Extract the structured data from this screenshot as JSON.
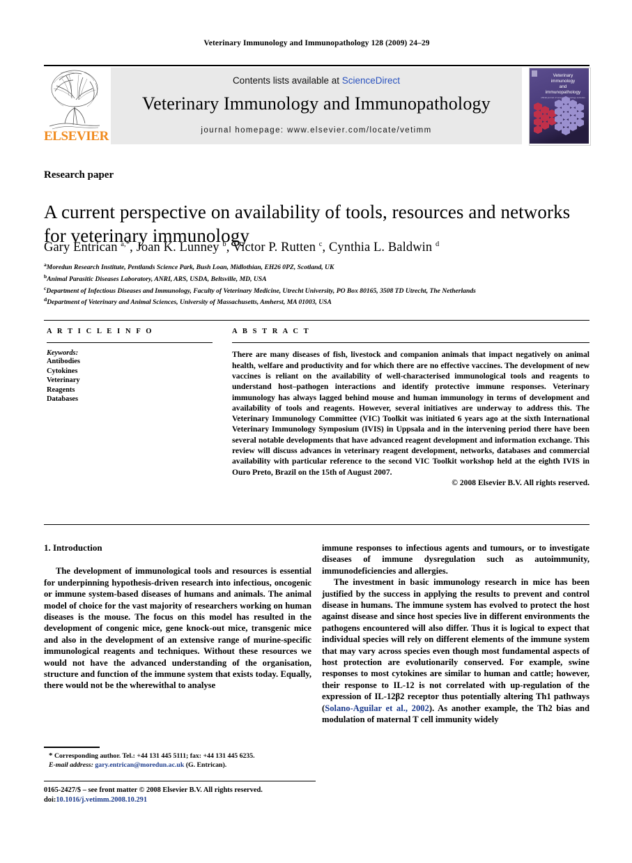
{
  "running_head": "Veterinary Immunology and Immunopathology 128 (2009) 24–29",
  "masthead": {
    "contents_prefix": "Contents lists available at ",
    "sciencedirect": "ScienceDirect",
    "journal_title": "Veterinary Immunology and Immunopathology",
    "homepage": "journal homepage: www.elsevier.com/locate/vetimm",
    "publisher": "ELSEVIER",
    "publisher_color": "#f08a1d",
    "cover": {
      "line1": "Veterinary",
      "line2": "immunology",
      "line3": "and",
      "line4": "immunopathology",
      "subtitle": "official journal of several immunology societies",
      "bg_color": "#4a3c7a",
      "accent_red": "#c0304a",
      "accent_purple": "#9b90cf"
    }
  },
  "article": {
    "type": "Research paper",
    "title": "A current perspective on availability of tools, resources and networks for veterinary immunology",
    "authors_html": "Gary Entrican <sup>a,*</sup>, Joan K. Lunney <sup>b</sup>, Victor P. Rutten <sup>c</sup>, Cynthia L. Baldwin <sup>d</sup>",
    "affiliations": [
      {
        "marker": "a",
        "text": "Moredun Research Institute, Pentlands Science Park, Bush Loan, Midlothian, EH26 0PZ, Scotland, UK"
      },
      {
        "marker": "b",
        "text": "Animal Parasitic Diseases Laboratory, ANRI, ARS, USDA, Beltsville, MD, USA"
      },
      {
        "marker": "c",
        "text": "Department of Infectious Diseases and Immunology, Faculty of Veterinary Medicine, Utrecht University, PO Box 80165, 3508 TD Utrecht, The Netherlands"
      },
      {
        "marker": "d",
        "text": "Department of Veterinary and Animal Sciences, University of Massachusetts, Amherst, MA 01003, USA"
      }
    ]
  },
  "article_info": {
    "heading": "A R T I C L E   I N F O",
    "keywords_label": "Keywords:",
    "keywords": [
      "Antibodies",
      "Cytokines",
      "Veterinary",
      "Reagents",
      "Databases"
    ]
  },
  "abstract": {
    "heading": "A B S T R A C T",
    "text": "There are many diseases of fish, livestock and companion animals that impact negatively on animal health, welfare and productivity and for which there are no effective vaccines. The development of new vaccines is reliant on the availability of well-characterised immunological tools and reagents to understand host–pathogen interactions and identify protective immune responses. Veterinary immunology has always lagged behind mouse and human immunology in terms of development and availability of tools and reagents. However, several initiatives are underway to address this. The Veterinary Immunology Committee (VIC) Toolkit was initiated 6 years ago at the sixth International Veterinary Immunology Symposium (IVIS) in Uppsala and in the intervening period there have been several notable developments that have advanced reagent development and information exchange. This review will discuss advances in veterinary reagent development, networks, databases and commercial availability with particular reference to the second VIC Toolkit workshop held at the eighth IVIS in Ouro Preto, Brazil on the 15th of August 2007.",
    "copyright": "© 2008 Elsevier B.V. All rights reserved."
  },
  "body": {
    "section_title": "1. Introduction",
    "left_paragraphs": [
      "The development of immunological tools and resources is essential for underpinning hypothesis-driven research into infectious, oncogenic or immune system-based diseases of humans and animals. The animal model of choice for the vast majority of researchers working on human diseases is the mouse. The focus on this model has resulted in the development of congenic mice, gene knock-out mice, transgenic mice and also in the development of an extensive range of murine-specific immunological reagents and techniques. Without these resources we would not have the advanced understanding of the organisation, structure and function of the immune system that exists today. Equally, there would not be the wherewithal to analyse"
    ],
    "right_paragraph_continuation": "immune responses to infectious agents and tumours, or to investigate diseases of immune dysregulation such as autoimmunity, immunodeficiencies and allergies.",
    "right_paragraph_2_part1": "The investment in basic immunology research in mice has been justified by the success in applying the results to prevent and control disease in humans. The immune system has evolved to protect the host against disease and since host species live in different environments the pathogens encountered will also differ. Thus it is logical to expect that individual species will rely on different elements of the immune system that may vary across species even though most fundamental aspects of host protection are evolutionarily conserved. For example, swine responses to most cytokines are similar to human and cattle; however, their response to IL-12 is not correlated with up-regulation of the expression of IL-12β2 receptor thus potentially altering Th1 pathways (",
    "right_citation": "Solano-Aguilar et al., 2002",
    "right_paragraph_2_part2": "). As another example, the Th2 bias and modulation of maternal T cell immunity widely"
  },
  "footnotes": {
    "marker": "*",
    "corresponding": "Corresponding author. Tel.: +44 131 445 5111; fax: +44 131 445 6235.",
    "email_label": "E-mail address:",
    "email": "gary.entrican@moredun.ac.uk",
    "email_owner": "(G. Entrican).",
    "issn_line": "0165-2427/$ – see front matter © 2008 Elsevier B.V. All rights reserved.",
    "doi_prefix": "doi:",
    "doi": "10.1016/j.vetimm.2008.10.291"
  }
}
